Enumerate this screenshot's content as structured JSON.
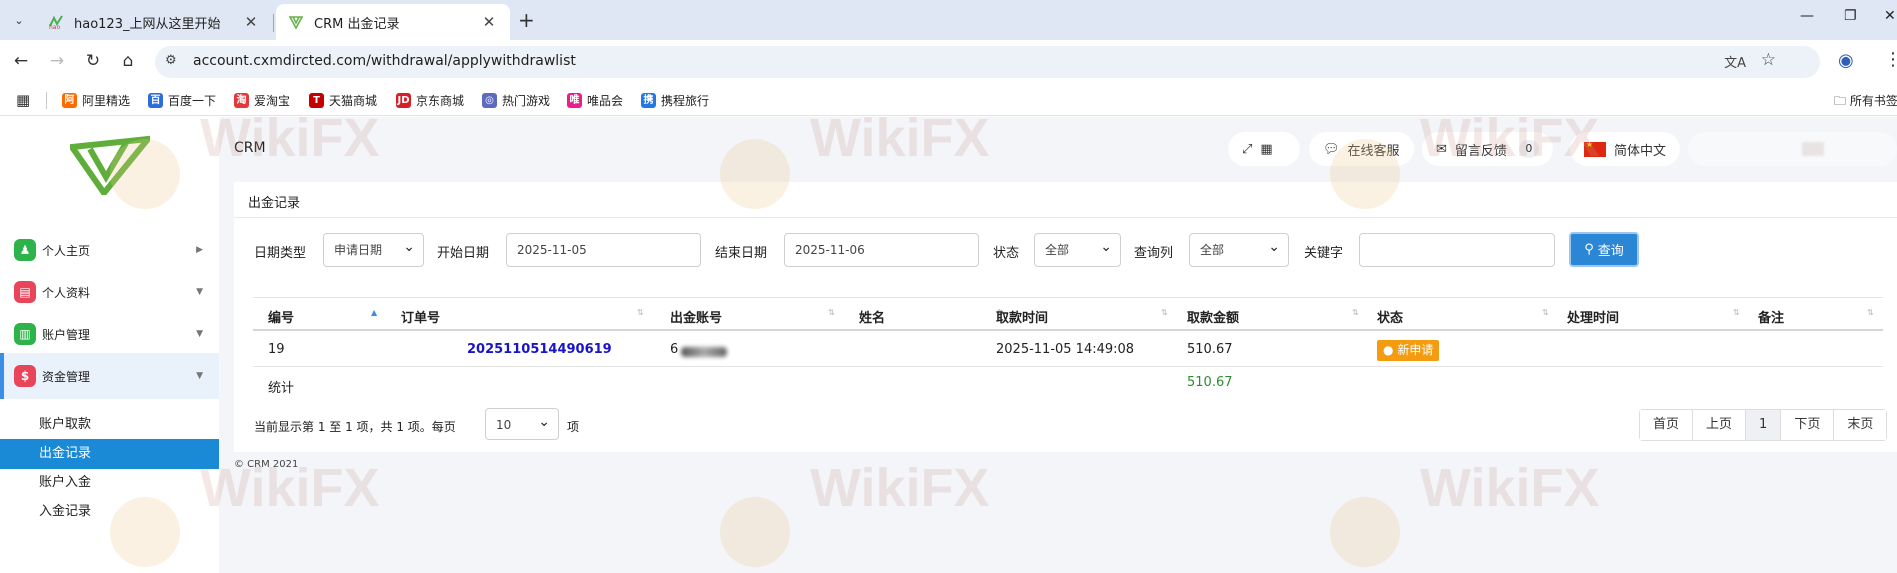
{
  "browser": {
    "tabs": [
      {
        "title": "hao123_上网从这里开始",
        "active": false
      },
      {
        "title": "CRM 出金记录",
        "active": true
      }
    ],
    "url": "account.cxmdircted.com/withdrawal/applywithdrawlist",
    "bookmarks": [
      "阿里精选",
      "百度一下",
      "爱淘宝",
      "天猫商城",
      "京东商城",
      "热门游戏",
      "唯品会",
      "携程旅行"
    ],
    "all_bookmarks": "所有书签"
  },
  "header": {
    "crm": "CRM",
    "online_service": "在线客服",
    "feedback": "留言反馈",
    "feedback_count": "0",
    "language": "简体中文"
  },
  "sidebar": {
    "items": [
      {
        "label": "个人主页",
        "color": "#2db34a"
      },
      {
        "label": "个人资料",
        "color": "#e8445a"
      },
      {
        "label": "账户管理",
        "color": "#2db34a"
      },
      {
        "label": "资金管理",
        "color": "#e8445a"
      }
    ],
    "sub_items": [
      "账户取款",
      "出金记录",
      "账户入金",
      "入金记录"
    ],
    "active_sub": "出金记录"
  },
  "panel": {
    "title": "出金记录",
    "filters": {
      "date_type_label": "日期类型",
      "date_type_value": "申请日期",
      "start_label": "开始日期",
      "start_value": "2025-11-05",
      "end_label": "结束日期",
      "end_value": "2025-11-06",
      "status_label": "状态",
      "status_value": "全部",
      "query_col_label": "查询列",
      "query_col_value": "全部",
      "keyword_label": "关键字",
      "keyword_value": "",
      "search_label": "查询"
    },
    "table": {
      "headers": [
        "编号",
        "订单号",
        "出金账号",
        "姓名",
        "取款时间",
        "取款金额",
        "状态",
        "处理时间",
        "备注"
      ],
      "rows": [
        {
          "id": "19",
          "order": "2025110514490619",
          "account_prefix": "6",
          "name": "",
          "time": "2025-11-05 14:49:08",
          "amount": "510.67",
          "status": "新申请",
          "processed": "",
          "remark": ""
        }
      ],
      "total_label": "统计",
      "total_amount": "510.67"
    },
    "pagination": {
      "summary_prefix": "当前显示第 1 至 1 项，共 1 项。每页",
      "page_size": "10",
      "summary_suffix": "项",
      "first": "首页",
      "prev": "上页",
      "current": "1",
      "next": "下页",
      "last": "末页"
    }
  },
  "footer": "© CRM 2021",
  "watermark": "WikiFX"
}
